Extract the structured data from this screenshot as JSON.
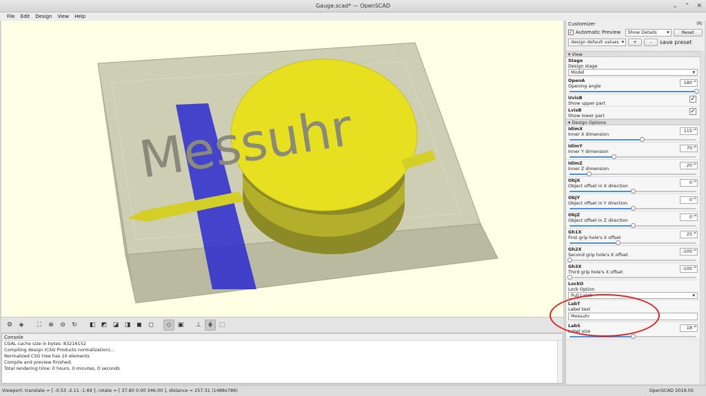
{
  "window": {
    "title": "Gauge.scad* — OpenSCAD",
    "controls": [
      "⌄",
      "⌃",
      "✕"
    ]
  },
  "menu": [
    "File",
    "Edit",
    "Design",
    "View",
    "Help"
  ],
  "model": {
    "label": "Messuhr",
    "colors": {
      "background": "#ffffe5",
      "disc": "#e6e020",
      "box": "#b8b89a",
      "stripe": "#2828c8",
      "text": "#8a8a7a"
    }
  },
  "toolbar_icons": [
    "preview-icon",
    "render-icon",
    "zoom-all-icon",
    "zoom-in-icon",
    "zoom-out-icon",
    "reset-view-icon",
    "view-right-icon",
    "view-top-icon",
    "view-bottom-icon",
    "view-left-icon",
    "view-front-icon",
    "view-back-icon",
    "perspective-icon",
    "orthogonal-icon",
    "axes-icon",
    "scale-markers-icon",
    "edges-icon"
  ],
  "console": {
    "title": "Console",
    "lines": [
      "CGAL cache size in bytes: 83216152",
      "Compiling design (CSG Products normalization)...",
      "Normalized CSG tree has 10 elements",
      "Compile and preview finished.",
      "Total rendering time: 0 hours, 0 minutes, 0 seconds"
    ]
  },
  "status": {
    "viewport": "Viewport: translate = [ -0.53 -2.11 -1.69 ], rotate = [ 37.80 0.00 346.00 ], distance = 257.31 (1488x786)",
    "version": "OpenSCAD 2019.05"
  },
  "customizer": {
    "title": "Customizer",
    "float_icon": "(R)",
    "auto_preview_label": "Automatic Preview",
    "show_details": "Show Details",
    "reset_label": "Reset",
    "preset": "design default values",
    "add_label": "+",
    "remove_label": "-",
    "save_preset_label": "save preset",
    "sections": [
      {
        "title": "View",
        "params": [
          {
            "kind": "combo",
            "name": "Stage",
            "desc": "Design stage",
            "value": "Model"
          },
          {
            "kind": "spin",
            "name": "OpenA",
            "desc": "Opening angle",
            "value": "180",
            "level": 1.0
          },
          {
            "kind": "check",
            "name": "UvisB",
            "desc": "Show upper part",
            "checked": "✓"
          },
          {
            "kind": "check",
            "name": "LvisB",
            "desc": "Show lower part",
            "checked": "✓"
          }
        ]
      },
      {
        "title": "Design Options",
        "params": [
          {
            "kind": "spin",
            "name": "IdimX",
            "desc": "Inner X dimension",
            "value": "115",
            "level": 0.57
          },
          {
            "kind": "spin",
            "name": "IdimY",
            "desc": "Inner Y dimension",
            "value": "70",
            "level": 0.35
          },
          {
            "kind": "spin",
            "name": "IdimZ",
            "desc": "Inner Z dimension",
            "value": "20",
            "level": 0.15
          },
          {
            "kind": "spin",
            "name": "ObjX",
            "desc": "Object offset in X direction",
            "value": "0",
            "level": 0.5
          },
          {
            "kind": "spin",
            "name": "ObjY",
            "desc": "Object offset in Y direction",
            "value": "0",
            "level": 0.5
          },
          {
            "kind": "spin",
            "name": "ObjZ",
            "desc": "Object offset in Z direction",
            "value": "0",
            "level": 0.5
          },
          {
            "kind": "spin",
            "name": "Gh1X",
            "desc": "First grip hole's X offset",
            "value": "25",
            "level": 0.38
          },
          {
            "kind": "spin",
            "name": "Gh2X",
            "desc": "Second grip hole's X offset",
            "value": "-100",
            "level": 0.0
          },
          {
            "kind": "spin",
            "name": "Gh3X",
            "desc": "Third grip hole's X offset",
            "value": "-100",
            "level": 0.0
          },
          {
            "kind": "combo",
            "name": "LockO",
            "desc": "Lock Option",
            "value": "Pull Latch"
          },
          {
            "kind": "text",
            "name": "LabT",
            "desc": "Label text",
            "value": "Messuhr"
          },
          {
            "kind": "spin",
            "name": "LabS",
            "desc": "Label size",
            "value": "18",
            "level": 0.5
          }
        ]
      }
    ]
  },
  "annotation": {
    "color": "#e02020"
  }
}
